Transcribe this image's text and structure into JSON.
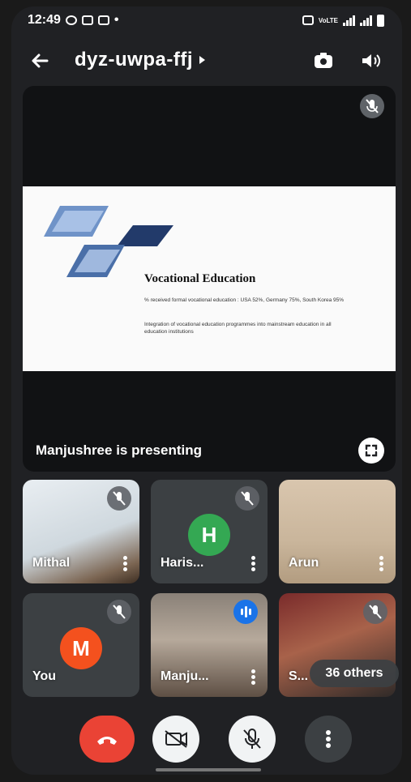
{
  "status_bar": {
    "time": "12:49",
    "dot": "•",
    "network_label": "VoLTE"
  },
  "header": {
    "back_icon": "arrow-left-icon",
    "meeting_code": "dyz-uwpa-ffj",
    "flip_camera_icon": "flip-camera-icon",
    "audio_output_icon": "speaker-icon"
  },
  "presentation": {
    "slide_title": "Vocational Education",
    "slide_line1": "% received formal vocational education : USA 52%, Germany 75%, South Korea 95%",
    "slide_line2": "Integration of vocational education programmes into mainstream education in all education institutions",
    "presenting_text": "Manjushree is presenting"
  },
  "participants": [
    {
      "name": "Mithal",
      "muted": true
    },
    {
      "name": "Haris...",
      "initial": "H",
      "avatar_color": "#34a853",
      "muted": true
    },
    {
      "name": "Arun",
      "muted": false
    },
    {
      "name": "You",
      "initial": "M",
      "avatar_color": "#f4511e",
      "muted": true
    },
    {
      "name": "Manju...",
      "speaking": true
    },
    {
      "name": "S...",
      "muted": true
    }
  ],
  "others_label": "36 others",
  "controls": {
    "end_call_color": "#ea4335",
    "camera_off_icon": "camera-off-icon",
    "mic_off_icon": "mic-off-icon",
    "more_icon": "more-vert-icon"
  }
}
